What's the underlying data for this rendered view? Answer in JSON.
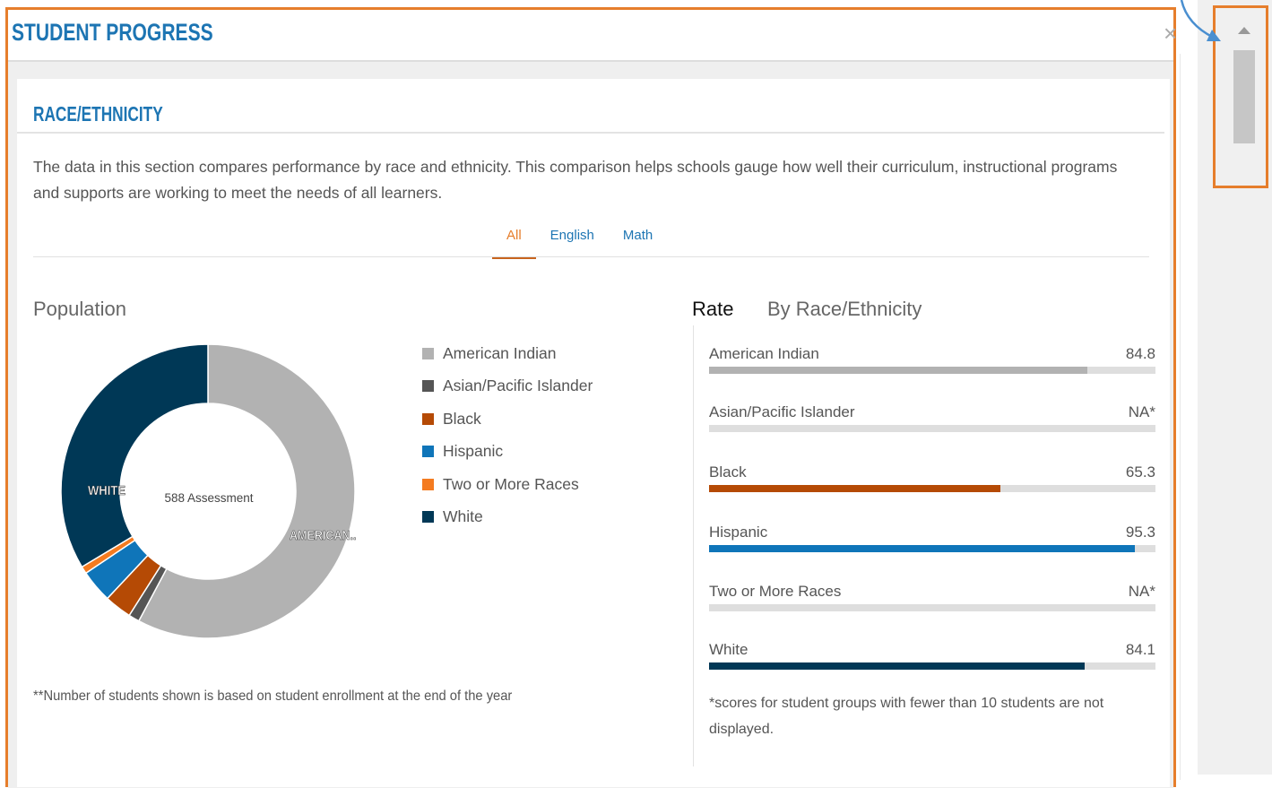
{
  "modal": {
    "title": "STUDENT PROGRESS",
    "close_label": "×"
  },
  "section": {
    "title": "RACE/ETHNICITY",
    "intro": "The data in this section compares performance by race and ethnicity. This comparison helps schools gauge how well their curriculum, instructional programs and supports are working to meet the needs of all learners."
  },
  "tabs": [
    {
      "label": "All",
      "active": true
    },
    {
      "label": "English",
      "active": false
    },
    {
      "label": "Math",
      "active": false
    }
  ],
  "population": {
    "heading": "Population",
    "center_label": "588 Assessment",
    "slice_labels": {
      "white": "WHITE",
      "american_indian": "AMERICAN..."
    },
    "footnote": "**Number of students shown is based on student enrollment at the end of the year"
  },
  "legend": [
    {
      "label": "American Indian",
      "color": "#b2b2b2"
    },
    {
      "label": "Asian/Pacific Islander",
      "color": "#555555"
    },
    {
      "label": "Black",
      "color": "#b54a05"
    },
    {
      "label": "Hispanic",
      "color": "#0f75b9"
    },
    {
      "label": "Two or More Races",
      "color": "#f47b20"
    },
    {
      "label": "White",
      "color": "#003856"
    }
  ],
  "rates": {
    "label": "Rate",
    "heading": "By Race/Ethnicity",
    "rows": [
      {
        "name": "American Indian",
        "value": "84.8",
        "rate": 84.8,
        "color": "#b2b2b2"
      },
      {
        "name": "Asian/Pacific Islander",
        "value": "NA*",
        "rate": 0,
        "color": "#555555"
      },
      {
        "name": "Black",
        "value": "65.3",
        "rate": 65.3,
        "color": "#b54a05"
      },
      {
        "name": "Hispanic",
        "value": "95.3",
        "rate": 95.3,
        "color": "#0f75b9"
      },
      {
        "name": "Two or More Races",
        "value": "NA*",
        "rate": 0,
        "color": "#f47b20"
      },
      {
        "name": "White",
        "value": "84.1",
        "rate": 84.1,
        "color": "#003856"
      }
    ],
    "footnote": "*scores for student groups with fewer than 10 students are not displayed."
  },
  "chart_data": {
    "type": "pie",
    "categories": [
      "American Indian",
      "Asian/Pacific Islander",
      "Black",
      "Hispanic",
      "Two or More Races",
      "White"
    ],
    "values": [
      57.8,
      1.2,
      3.0,
      3.6,
      0.8,
      33.6
    ],
    "colors": [
      "#b2b2b2",
      "#555555",
      "#b54a05",
      "#0f75b9",
      "#f47b20",
      "#003856"
    ],
    "center_text": "588 Assessment"
  }
}
